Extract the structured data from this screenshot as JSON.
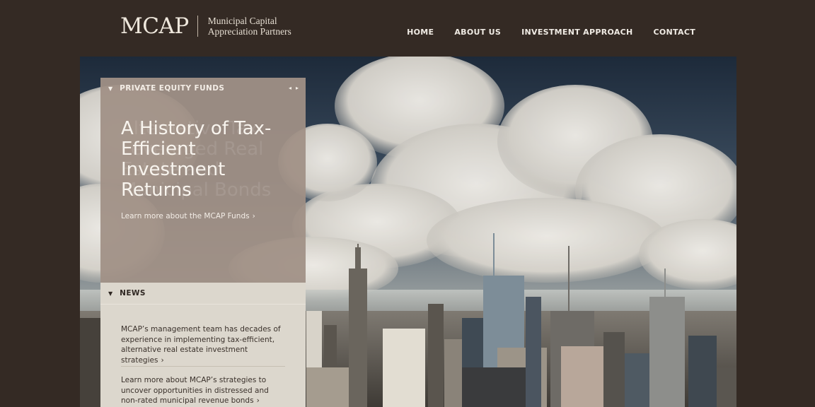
{
  "header": {
    "logo_mark": "MCAP",
    "logo_sub_line1": "Municipal Capital",
    "logo_sub_line2": "Appreciation Partners"
  },
  "nav": [
    {
      "label": "HOME"
    },
    {
      "label": "ABOUT US"
    },
    {
      "label": "INVESTMENT APPROACH"
    },
    {
      "label": "CONTACT"
    }
  ],
  "panel": {
    "section_label": "PRIVATE EQUITY FUNDS",
    "prev_icon": "◂",
    "next_icon": "▸",
    "slide_title": "A History of Tax-Efficient Investment Returns",
    "slide_link": "Learn more about the MCAP Funds",
    "ghost_title": "Alternative Tax Leveraged Real Estate and Municipal Bonds"
  },
  "news": {
    "section_label": "NEWS",
    "items": [
      {
        "text": "MCAP’s management team has decades of experience in implementing tax-efficient, alternative real estate investment strategies"
      },
      {
        "text": "Learn more about MCAP’s strategies to uncover opportunities in distressed and non-rated municipal revenue bonds"
      }
    ]
  },
  "colors": {
    "page_bg": "#342a24",
    "panel_overlay": "#a09186",
    "news_bg": "#dcd7cd"
  }
}
